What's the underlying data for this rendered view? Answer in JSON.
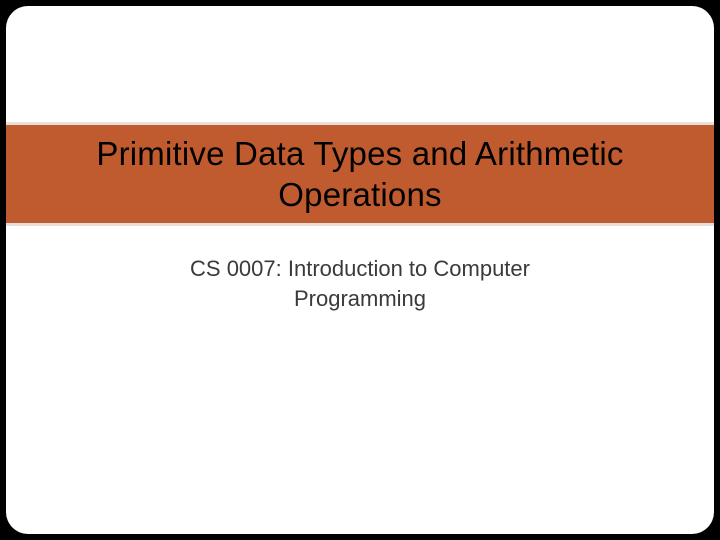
{
  "slide": {
    "title": "Primitive Data Types and Arithmetic Operations",
    "subtitle": "CS 0007:  Introduction to Computer Programming"
  }
}
